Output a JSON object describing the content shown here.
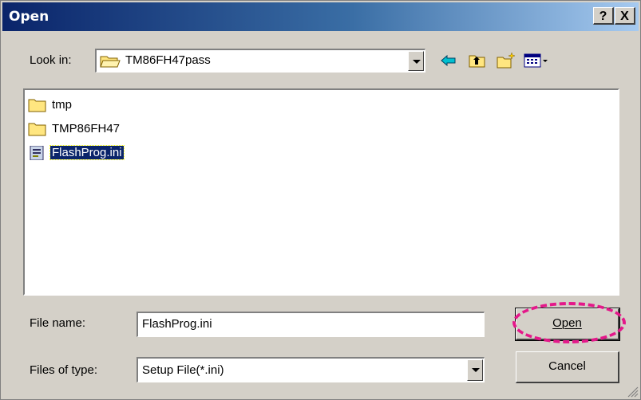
{
  "dialog": {
    "title": "Open",
    "help_glyph": "?",
    "close_glyph": "X"
  },
  "look_in": {
    "label": "Look in:",
    "value": "TM86FH47pass",
    "icon": "folder-open-icon"
  },
  "toolbar": {
    "back_icon": "back-arrow-icon",
    "up_icon": "up-folder-icon",
    "new_folder_icon": "new-folder-icon",
    "view_menu_icon": "view-menu-icon"
  },
  "files": [
    {
      "name": "tmp",
      "type": "folder",
      "selected": false
    },
    {
      "name": "TMP86FH47",
      "type": "folder",
      "selected": false
    },
    {
      "name": "FlashProg.ini",
      "type": "ini-file",
      "selected": true
    }
  ],
  "file_name": {
    "label": "File name:",
    "value": "FlashProg.ini"
  },
  "file_type": {
    "label": "Files of type:",
    "value": "Setup File(*.ini)"
  },
  "buttons": {
    "open": "Open",
    "cancel": "Cancel"
  },
  "colors": {
    "title_bar": "#0a246a",
    "selection": "#0a246a",
    "highlight_ring": "#e4188a",
    "face": "#d4d0c8"
  }
}
